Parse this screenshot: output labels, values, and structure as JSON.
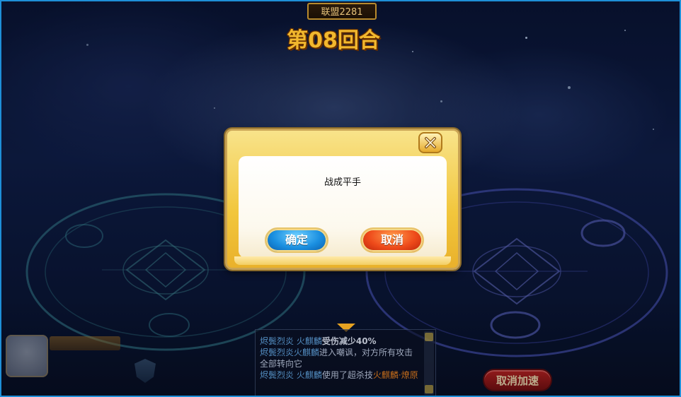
{
  "header": {
    "alliance_tag": "联盟2281",
    "round_title": "第08回合"
  },
  "dialog": {
    "message": "战成平手",
    "confirm_label": "确定",
    "cancel_label": "取消"
  },
  "battle_log": {
    "line1_actor": "烬鬓烈炎",
    "line1_pet": "火麒麟",
    "line1_text": "受伤减少40%",
    "line2_actor": "烬鬓烈炎",
    "line2_pet": "火麒麟",
    "line2_text": "进入嘲讽，对方所有攻击全部转向它",
    "line3_actor": "烬鬓烈炎",
    "line3_pet": "火麒麟",
    "line3_text": "使用了超杀技",
    "line3_skill": "火麒麟·燎原"
  },
  "controls": {
    "cancel_speed_label": "取消加速"
  },
  "colors": {
    "dialog_gold": "#f2c63c",
    "confirm_blue": "#1a8fe0",
    "cancel_orange": "#ee4a1a",
    "title_gold": "#f2b82e"
  }
}
